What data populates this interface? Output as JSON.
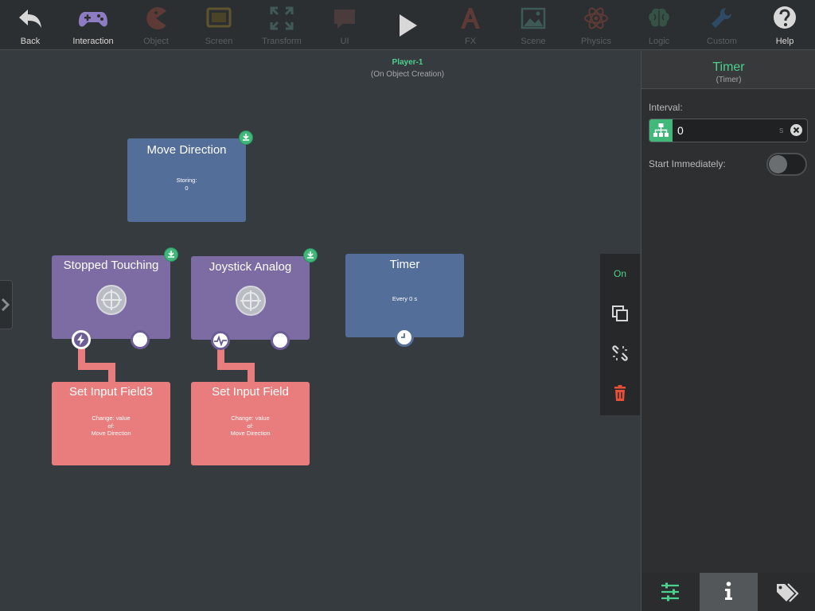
{
  "toolbar": {
    "items": [
      {
        "label": "Back",
        "icon": "back-arrow-icon",
        "dim": false
      },
      {
        "label": "Interaction",
        "icon": "gamepad-icon",
        "dim": false
      },
      {
        "label": "Object",
        "icon": "pacman-icon",
        "dim": true
      },
      {
        "label": "Screen",
        "icon": "tablet-icon",
        "dim": true
      },
      {
        "label": "Transform",
        "icon": "expand-arrows-icon",
        "dim": true
      },
      {
        "label": "UI",
        "icon": "speech-bubble-icon",
        "dim": true
      },
      {
        "label": "",
        "icon": "play-icon",
        "dim": false
      },
      {
        "label": "FX",
        "icon": "fx-icon",
        "dim": true
      },
      {
        "label": "Scene",
        "icon": "landscape-image-icon",
        "dim": true
      },
      {
        "label": "Physics",
        "icon": "atom-icon",
        "dim": true
      },
      {
        "label": "Logic",
        "icon": "brain-icon",
        "dim": true
      },
      {
        "label": "Custom",
        "icon": "wrench-icon",
        "dim": true
      },
      {
        "label": "Help",
        "icon": "question-icon",
        "dim": false
      }
    ]
  },
  "header": {
    "title": "Player-1",
    "subtitle": "(On Object Creation)"
  },
  "nodes": {
    "move_direction": {
      "title": "Move Direction",
      "line1": "Storing:",
      "line2": "0"
    },
    "stopped_touching": {
      "title": "Stopped Touching"
    },
    "joystick_analog": {
      "title": "Joystick Analog"
    },
    "timer": {
      "title": "Timer",
      "text": "Every 0 s"
    },
    "set_input_field3": {
      "title": "Set Input Field3",
      "line1": "Change: value",
      "line2": "of:",
      "line3": "Move Direction"
    },
    "set_input_field": {
      "title": "Set Input Field",
      "line1": "Change: value",
      "line2": "of:",
      "line3": "Move Direction"
    }
  },
  "actionbar": {
    "on_label": "On",
    "icons": [
      "duplicate-icon",
      "unlink-icon",
      "trash-icon"
    ]
  },
  "panel": {
    "title": "Timer",
    "subtitle": "(Timer)",
    "interval_label": "Interval:",
    "interval_value": "0",
    "interval_unit": "s",
    "start_label": "Start Immediately:",
    "start_immediately": false,
    "tabs": [
      "sliders-icon",
      "info-icon",
      "tags-icon"
    ],
    "active_tab": 1
  },
  "colors": {
    "accent": "#4cd08d",
    "logic_node": "#546e9a",
    "interaction_node": "#7d6ba4",
    "action_node": "#e97c7c",
    "delete": "#e8503a"
  }
}
